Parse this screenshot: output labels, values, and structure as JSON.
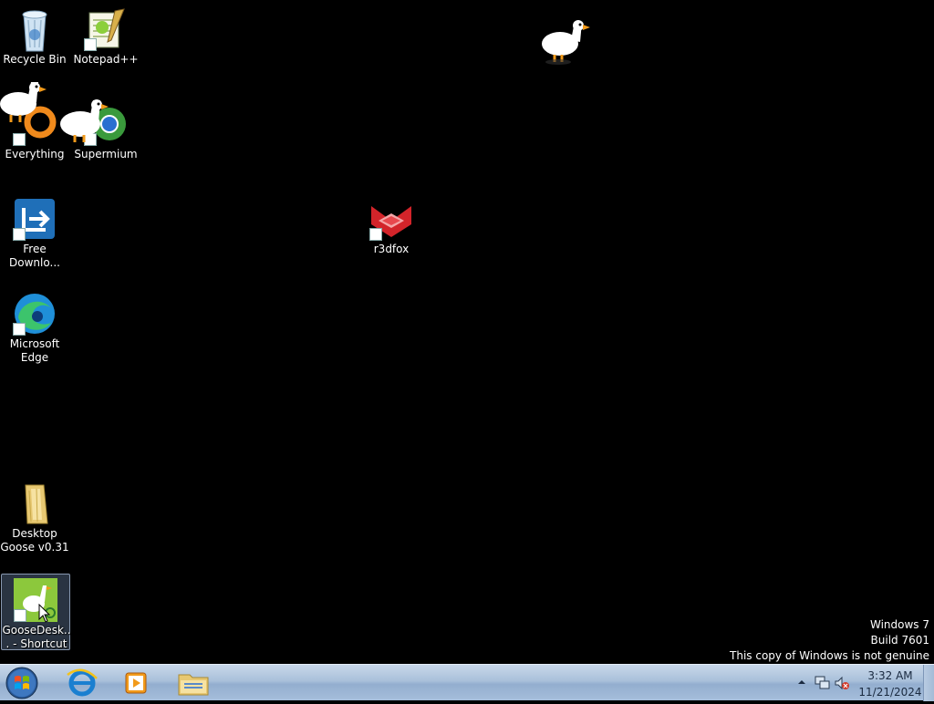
{
  "desktop": {
    "icons": [
      {
        "label": "Recycle Bin"
      },
      {
        "label": "Notepad++"
      },
      {
        "label": "Everything"
      },
      {
        "label": "Supermium"
      },
      {
        "label": "Free Downlo..."
      },
      {
        "label": "Microsoft Edge"
      },
      {
        "label": "r3dfox"
      },
      {
        "label": "Desktop Goose v0.31"
      },
      {
        "label": "GooseDesk... - Shortcut"
      }
    ]
  },
  "watermark": {
    "line1": "Windows 7",
    "line2": "Build 7601",
    "line3": "This copy of Windows is not genuine"
  },
  "taskbar": {
    "pinned": [
      {
        "icon": "internet-explorer-icon"
      },
      {
        "icon": "media-player-icon"
      },
      {
        "icon": "windows-explorer-icon"
      }
    ],
    "clock": {
      "time": "3:32 AM",
      "date": "11/21/2024"
    }
  },
  "colors": {
    "desktop_background": "#000000",
    "taskbar": "#a9c0da"
  }
}
